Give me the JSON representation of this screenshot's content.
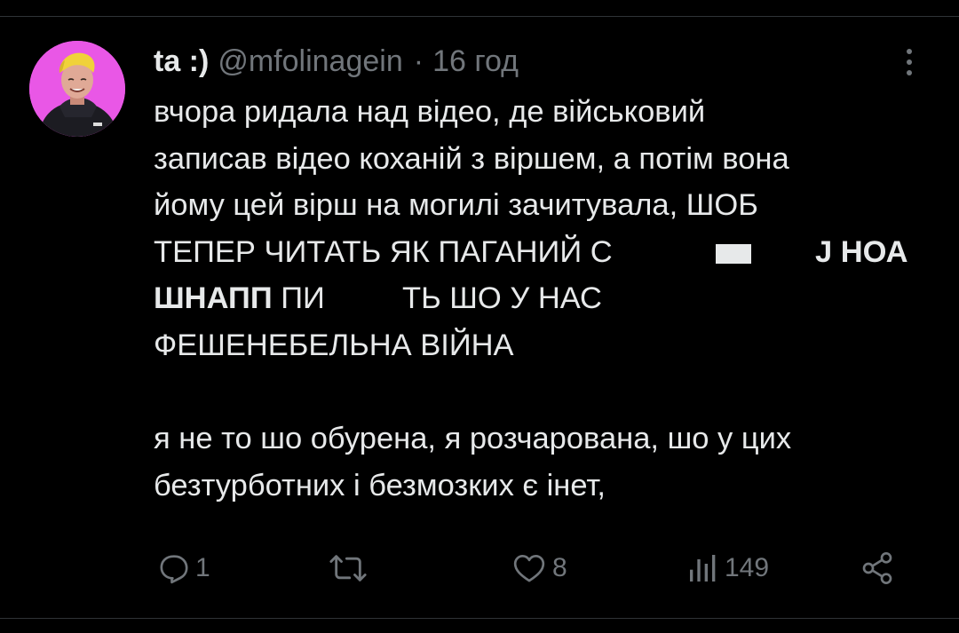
{
  "tweet": {
    "author": {
      "display_name": "ta :)",
      "handle": "@mfolinagein",
      "separator": "·",
      "time": "16 год",
      "avatar_bg": "#e957e6"
    },
    "lines": [
      "вчора ридала над відео, де військовий",
      "записав відео коханій з віршем, а потім вона",
      "йому цей вірш на могилі зачитувала, ШОБ",
      "ТЕПЕР ЧИТАТЬ ЯК ПАГАНИЙ С",
      "Ј НОА",
      "ШНАПП",
      "ПИ",
      "ТЬ ШО У НАС",
      "ФЕШЕНЕБЕЛЬНА ВІЙНА",
      "я не то шо обурена, я розчарована, шо у цих",
      "безтурботних і безмозких є інет,"
    ],
    "actions": {
      "reply_count": "1",
      "retweet_count": "",
      "like_count": "8",
      "views_count": "149"
    }
  },
  "icons": {
    "more": "more-vertical-icon",
    "reply": "reply-icon",
    "retweet": "retweet-icon",
    "like": "heart-icon",
    "views": "views-chart-icon",
    "share": "share-icon"
  },
  "colors": {
    "background": "#000000",
    "text": "#e7e9ea",
    "muted": "#71767b",
    "divider": "#2f3336"
  }
}
